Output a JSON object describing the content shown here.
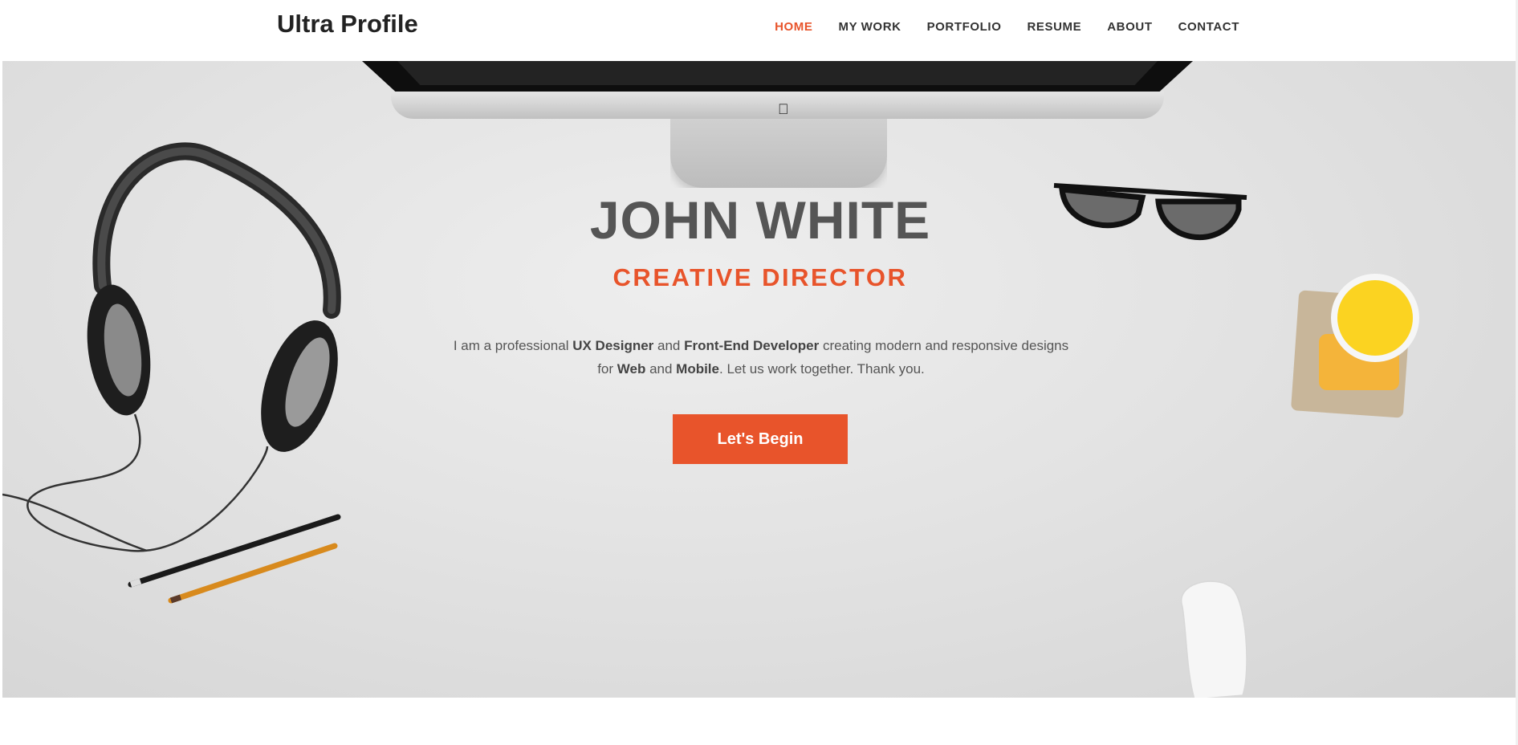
{
  "brand": "Ultra Profile",
  "nav": [
    "HOME",
    "MY WORK",
    "PORTFOLIO",
    "RESUME",
    "ABOUT",
    "CONTACT"
  ],
  "nav_active": "HOME",
  "hero": {
    "name": "JOHN WHITE",
    "title": "CREATIVE DIRECTOR",
    "desc": {
      "t1": "I am a professional ",
      "b1": "UX Designer",
      "t2": " and ",
      "b2": "Front-End Developer",
      "t3": " creating modern and responsive designs for ",
      "b3": "Web",
      "t4": " and ",
      "b4": "Mobile",
      "t5": ". Let us work together. Thank you."
    },
    "cta": "Let's Begin"
  },
  "colors": {
    "accent": "#e8542b",
    "text": "#555555",
    "brand": "#222222"
  },
  "icons": {
    "monitor_logo": "apple-icon"
  }
}
